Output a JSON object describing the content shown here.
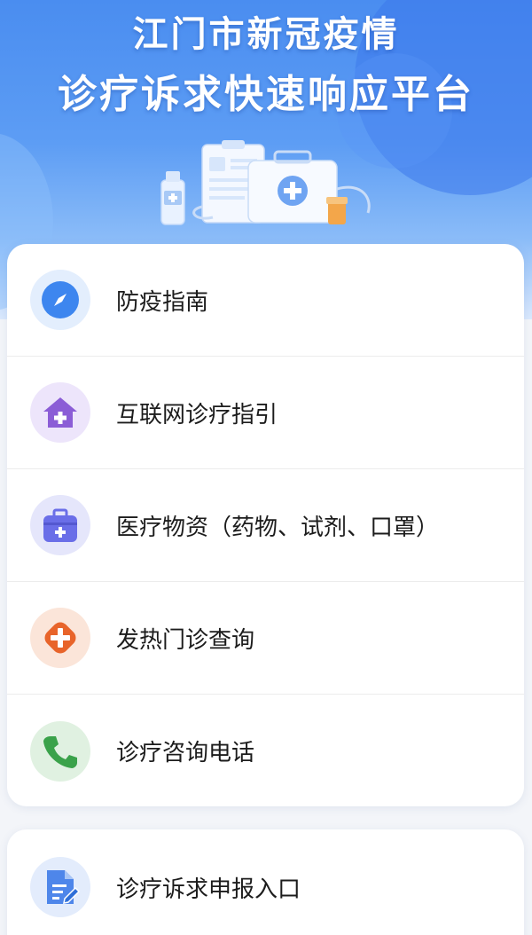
{
  "hero": {
    "title_line1": "江门市新冠疫情",
    "title_line2": "诊疗诉求快速响应平台"
  },
  "menu": {
    "items": [
      {
        "label": "防疫指南",
        "icon": "compass-icon",
        "color": "#3d86ef"
      },
      {
        "label": "互联网诊疗指引",
        "icon": "home-plus-icon",
        "color": "#8b5dd6"
      },
      {
        "label": "医疗物资（药物、试剂、口罩）",
        "icon": "medkit-icon",
        "color": "#6a6ee8"
      },
      {
        "label": "发热门诊查询",
        "icon": "plus-badge-icon",
        "color": "#e8642a"
      },
      {
        "label": "诊疗咨询电话",
        "icon": "phone-icon",
        "color": "#3aa24a"
      }
    ]
  },
  "secondary": {
    "items": [
      {
        "label": "诊疗诉求申报入口",
        "icon": "document-edit-icon",
        "color": "#4e86ea"
      }
    ]
  }
}
